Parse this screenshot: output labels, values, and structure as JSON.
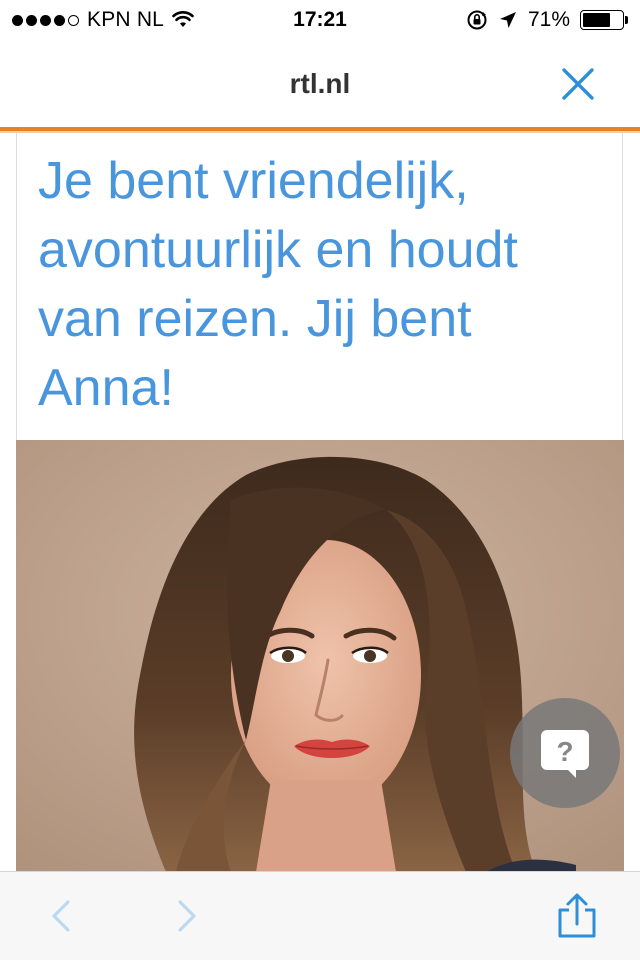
{
  "status_bar": {
    "carrier": "KPN NL",
    "time": "17:21",
    "battery_percent": "71%",
    "battery_level": 0.71,
    "signal_bars": 4,
    "signal_total": 5
  },
  "nav": {
    "title": "rtl.nl",
    "close_icon": "close-icon"
  },
  "content": {
    "heading": "Je bent vriendelijk, avontuurlijk en houdt van reizen. Jij bent Anna!",
    "photo_icon": "portrait-photo",
    "help_icon": "question-bubble-icon",
    "help_symbol": "?"
  },
  "toolbar": {
    "back_icon": "chevron-left-icon",
    "forward_icon": "chevron-right-icon",
    "share_icon": "share-icon"
  },
  "colors": {
    "accent_blue": "#4a96dc",
    "progress_orange": "#e8821e",
    "toolbar_bg": "#f7f7f7"
  }
}
